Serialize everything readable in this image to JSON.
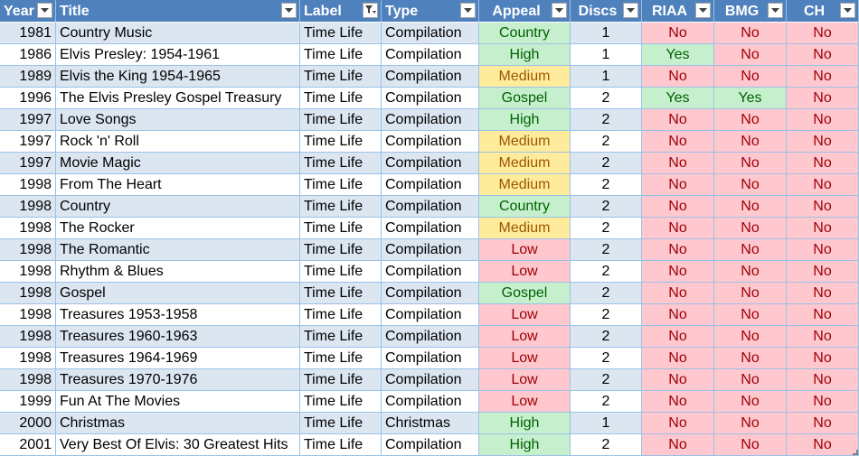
{
  "table": {
    "headers": {
      "year": "Year",
      "title": "Title",
      "label": "Label",
      "type": "Type",
      "appeal": "Appeal",
      "discs": "Discs",
      "riaa": "RIAA",
      "bmg": "BMG",
      "ch": "CH"
    },
    "filtered_column": "label",
    "rows": [
      {
        "year": "1981",
        "title": "Country Music",
        "label": "Time Life",
        "type": "Compilation",
        "appeal": "Country",
        "discs": "1",
        "riaa": "No",
        "bmg": "No",
        "ch": "No"
      },
      {
        "year": "1986",
        "title": "Elvis Presley: 1954-1961",
        "label": "Time Life",
        "type": "Compilation",
        "appeal": "High",
        "discs": "1",
        "riaa": "Yes",
        "bmg": "No",
        "ch": "No"
      },
      {
        "year": "1989",
        "title": "Elvis the King 1954-1965",
        "label": "Time Life",
        "type": "Compilation",
        "appeal": "Medium",
        "discs": "1",
        "riaa": "No",
        "bmg": "No",
        "ch": "No"
      },
      {
        "year": "1996",
        "title": "The Elvis Presley Gospel Treasury",
        "label": "Time Life",
        "type": "Compilation",
        "appeal": "Gospel",
        "discs": "2",
        "riaa": "Yes",
        "bmg": "Yes",
        "ch": "No"
      },
      {
        "year": "1997",
        "title": "Love Songs",
        "label": "Time Life",
        "type": "Compilation",
        "appeal": "High",
        "discs": "2",
        "riaa": "No",
        "bmg": "No",
        "ch": "No"
      },
      {
        "year": "1997",
        "title": "Rock 'n' Roll",
        "label": "Time Life",
        "type": "Compilation",
        "appeal": "Medium",
        "discs": "2",
        "riaa": "No",
        "bmg": "No",
        "ch": "No"
      },
      {
        "year": "1997",
        "title": "Movie Magic",
        "label": "Time Life",
        "type": "Compilation",
        "appeal": "Medium",
        "discs": "2",
        "riaa": "No",
        "bmg": "No",
        "ch": "No"
      },
      {
        "year": "1998",
        "title": "From The Heart",
        "label": "Time Life",
        "type": "Compilation",
        "appeal": "Medium",
        "discs": "2",
        "riaa": "No",
        "bmg": "No",
        "ch": "No"
      },
      {
        "year": "1998",
        "title": "Country",
        "label": "Time Life",
        "type": "Compilation",
        "appeal": "Country",
        "discs": "2",
        "riaa": "No",
        "bmg": "No",
        "ch": "No"
      },
      {
        "year": "1998",
        "title": "The Rocker",
        "label": "Time Life",
        "type": "Compilation",
        "appeal": "Medium",
        "discs": "2",
        "riaa": "No",
        "bmg": "No",
        "ch": "No"
      },
      {
        "year": "1998",
        "title": "The Romantic",
        "label": "Time Life",
        "type": "Compilation",
        "appeal": "Low",
        "discs": "2",
        "riaa": "No",
        "bmg": "No",
        "ch": "No"
      },
      {
        "year": "1998",
        "title": "Rhythm & Blues",
        "label": "Time Life",
        "type": "Compilation",
        "appeal": "Low",
        "discs": "2",
        "riaa": "No",
        "bmg": "No",
        "ch": "No"
      },
      {
        "year": "1998",
        "title": "Gospel",
        "label": "Time Life",
        "type": "Compilation",
        "appeal": "Gospel",
        "discs": "2",
        "riaa": "No",
        "bmg": "No",
        "ch": "No"
      },
      {
        "year": "1998",
        "title": "Treasures 1953-1958",
        "label": "Time Life",
        "type": "Compilation",
        "appeal": "Low",
        "discs": "2",
        "riaa": "No",
        "bmg": "No",
        "ch": "No"
      },
      {
        "year": "1998",
        "title": "Treasures 1960-1963",
        "label": "Time Life",
        "type": "Compilation",
        "appeal": "Low",
        "discs": "2",
        "riaa": "No",
        "bmg": "No",
        "ch": "No"
      },
      {
        "year": "1998",
        "title": "Treasures 1964-1969",
        "label": "Time Life",
        "type": "Compilation",
        "appeal": "Low",
        "discs": "2",
        "riaa": "No",
        "bmg": "No",
        "ch": "No"
      },
      {
        "year": "1998",
        "title": "Treasures 1970-1976",
        "label": "Time Life",
        "type": "Compilation",
        "appeal": "Low",
        "discs": "2",
        "riaa": "No",
        "bmg": "No",
        "ch": "No"
      },
      {
        "year": "1999",
        "title": "Fun At The Movies",
        "label": "Time Life",
        "type": "Compilation",
        "appeal": "Low",
        "discs": "2",
        "riaa": "No",
        "bmg": "No",
        "ch": "No"
      },
      {
        "year": "2000",
        "title": "Christmas",
        "label": "Time Life",
        "type": "Christmas",
        "appeal": "High",
        "discs": "1",
        "riaa": "No",
        "bmg": "No",
        "ch": "No"
      },
      {
        "year": "2001",
        "title": "Very Best Of Elvis: 30 Greatest Hits",
        "label": "Time Life",
        "type": "Compilation",
        "appeal": "High",
        "discs": "2",
        "riaa": "No",
        "bmg": "No",
        "ch": "No"
      }
    ]
  },
  "colors": {
    "header_bg": "#4f81bd",
    "band_bg": "#dce6f1",
    "good_fill": "#c6efce",
    "good_text": "#006100",
    "neutral_fill": "#ffeb9c",
    "neutral_text": "#9c5700",
    "bad_fill": "#ffc7ce",
    "bad_text": "#9c0006"
  },
  "icons": {
    "filter_dropdown": "chevron-down-icon",
    "filter_active": "filter-active-icon"
  }
}
